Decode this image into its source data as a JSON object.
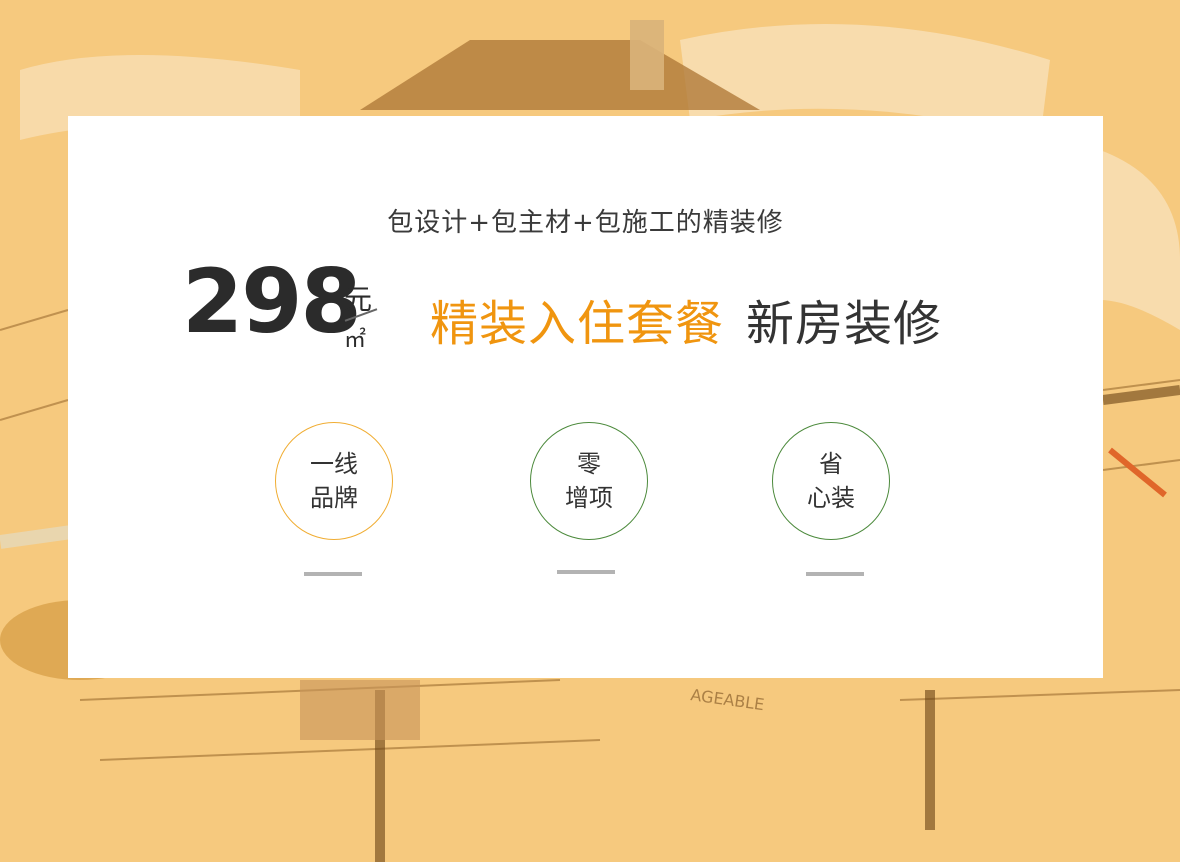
{
  "tagline": "包设计+包主材+包施工的精装修",
  "price": {
    "amount": "298",
    "unit_top": "元",
    "unit_bottom": "㎡"
  },
  "headline": {
    "highlight": "精装入住套餐",
    "rest": "新房装修"
  },
  "features": [
    {
      "line1": "一线",
      "line2": "品牌"
    },
    {
      "line1": "零",
      "line2": "增项"
    },
    {
      "line1": "省",
      "line2": "心装"
    }
  ],
  "colors": {
    "background": "#f6c97e",
    "accent_orange": "#f0950f",
    "circle_orange": "#f0ad33",
    "circle_green": "#4c8a3c",
    "divider_gray": "#b3b3b3"
  }
}
